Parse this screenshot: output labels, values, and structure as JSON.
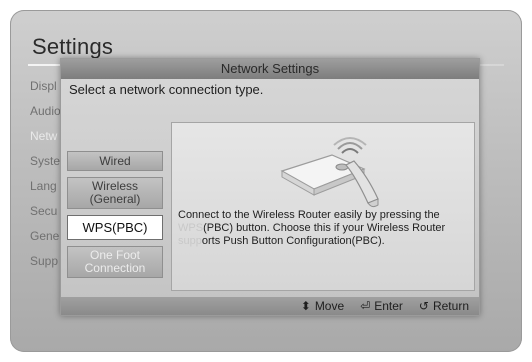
{
  "screen": {
    "title": "Settings"
  },
  "background_menu": {
    "items": [
      {
        "label": "Displ",
        "dim": false
      },
      {
        "label": "Audio",
        "dim": false
      },
      {
        "label": "Netw",
        "dim": true
      },
      {
        "label": "Syste",
        "dim": false
      },
      {
        "label": "Lang",
        "dim": false
      },
      {
        "label": "Secu",
        "dim": false
      },
      {
        "label": "Gene",
        "dim": false
      },
      {
        "label": "Supp",
        "dim": false
      }
    ]
  },
  "dialog": {
    "title": "Network Settings",
    "prompt": "Select a network connection type.",
    "options": [
      {
        "label_lines": [
          "Wired"
        ],
        "selected": false,
        "faded": false
      },
      {
        "label_lines": [
          "Wireless",
          "(General)"
        ],
        "selected": false,
        "faded": false
      },
      {
        "label_lines": [
          "WPS(PBC)"
        ],
        "selected": true,
        "faded": false
      },
      {
        "label_lines": [
          "One Foot",
          "Connection"
        ],
        "selected": false,
        "faded": true
      }
    ],
    "description": {
      "line1": "Connect to the Wireless Router easily by pressing the",
      "line2_prefix": "WPS",
      "line2_rest": "(PBC) button. Choose this if your Wireless Router",
      "line3_prefix": "supp",
      "line3_rest": "orts Push Button Configuration(PBC)."
    },
    "footer": {
      "move_icon": "up-down-arrows-icon",
      "move_glyph": "⬍",
      "move_label": "Move",
      "enter_icon": "enter-icon",
      "enter_glyph": "⏎",
      "enter_label": "Enter",
      "return_icon": "return-icon",
      "return_glyph": "↺",
      "return_label": "Return"
    }
  },
  "colors": {
    "dialog_header": "#8c8c8c",
    "selected_option": "#ffffff"
  }
}
